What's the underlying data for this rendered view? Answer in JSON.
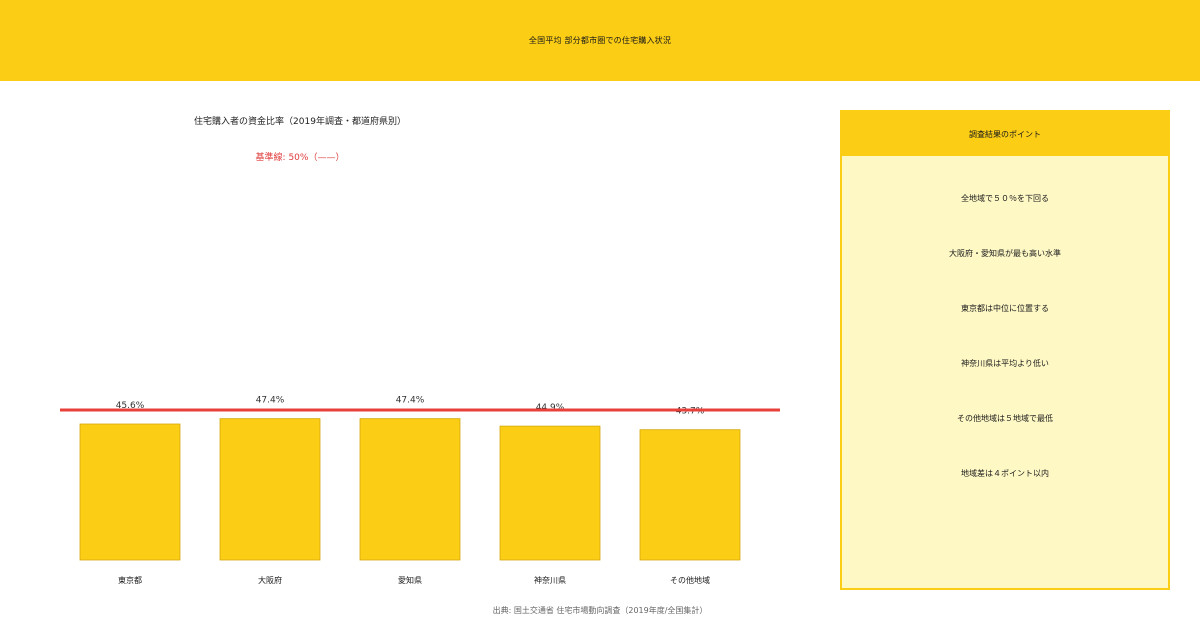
{
  "header": {
    "title": "全国平均 部分都市圏での住宅購入状況"
  },
  "chart": {
    "title": "住宅購入者の資金比率（2019年調査・都道府県別）",
    "subtitle": "基準線: 50%（——）"
  },
  "chart_data": {
    "type": "bar",
    "categories": [
      "東京都",
      "大阪府",
      "愛知県",
      "神奈川県",
      "その他地域"
    ],
    "values": [
      45.6,
      47.4,
      47.4,
      44.9,
      43.7
    ],
    "value_labels": [
      "45.6%",
      "47.4%",
      "47.4%",
      "44.9%",
      "43.7%"
    ],
    "reference_line": 50,
    "title": "住宅購入者の資金比率（2019年調査・都道府県別）",
    "xlabel": "",
    "ylabel": "",
    "grid": false,
    "colors": {
      "bar": "#FBCD15",
      "bar_edge": "#D4A90C",
      "reference": "#E8403A"
    }
  },
  "side_panel": {
    "title": "調査結果のポイント",
    "items": [
      "全地域で５０％を下回る",
      "大阪府・愛知県が最も高い水準",
      "東京都は中位に位置する",
      "神奈川県は平均より低い",
      "その他地域は５地域で最低",
      "地域差は４ポイント以内"
    ]
  },
  "footer": {
    "source": "出典: 国土交通省 住宅市場動向調査（2019年度/全国集計）"
  },
  "colors": {
    "accent": "#FBCD15",
    "panel_bg": "#FEF8C5",
    "reference": "#E8403A"
  }
}
